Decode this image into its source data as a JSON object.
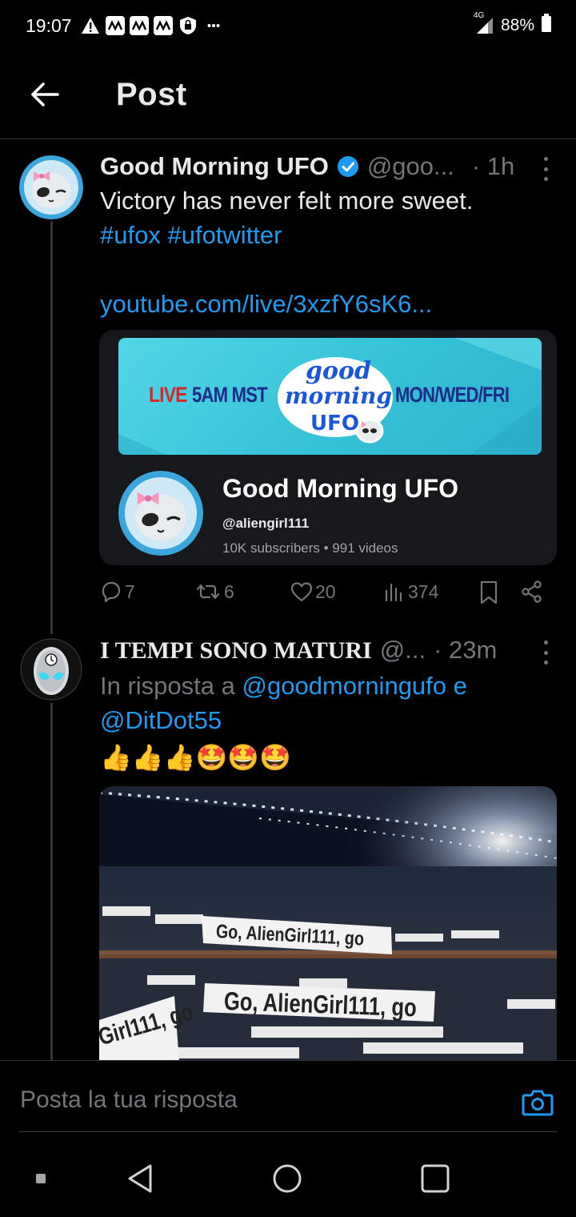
{
  "status_bar": {
    "time": "19:07",
    "network": "4G",
    "battery": "88%",
    "icons": [
      "alert-icon",
      "notification-icon",
      "notification-icon",
      "notification-icon",
      "lock-shield-icon",
      "more-dots-icon",
      "signal-icon",
      "battery-icon"
    ]
  },
  "header": {
    "title": "Post",
    "back_icon": "arrow-left-icon"
  },
  "post": {
    "name": "Good Morning UFO",
    "handle": "@goo...",
    "time": "· 1h",
    "text_line1": "Victory has never felt more sweet.",
    "hashtag1": "#ufox",
    "hashtag2": "#ufotwitter",
    "link": "youtube.com/live/3xzfY6sK6...",
    "card": {
      "banner_live": "LIVE",
      "banner_time": "5AM MST",
      "banner_days": "MON/WED/FRI",
      "banner_logo_line1": "good",
      "banner_logo_line2": "morning",
      "banner_logo_line3": "UFO",
      "channel_name": "Good Morning UFO",
      "channel_handle": "@aliengirl111",
      "channel_stats": "10K subscribers • 991 videos"
    },
    "actions": {
      "replies": "7",
      "reposts": "6",
      "likes": "20",
      "views": "374"
    }
  },
  "reply": {
    "name": "I TEMPI SONO MATURI",
    "handle": "@...",
    "time": "· 23m",
    "reply_prefix": "In risposta a",
    "reply_to1": "@goodmorningufo",
    "reply_joiner": "e",
    "reply_to2": "@DitDot55",
    "emoji_text": "👍👍👍🤩🤩🤩",
    "image_banner1": "Go, AlienGirl111, go",
    "image_banner2": "Go, AlienGirl111, go",
    "image_banner3": "Girl111, go"
  },
  "composer": {
    "placeholder": "Posta la tua risposta"
  },
  "colors": {
    "accent": "#1d9bf0",
    "background": "#000000",
    "muted": "#71767b",
    "card": "#16181c"
  }
}
